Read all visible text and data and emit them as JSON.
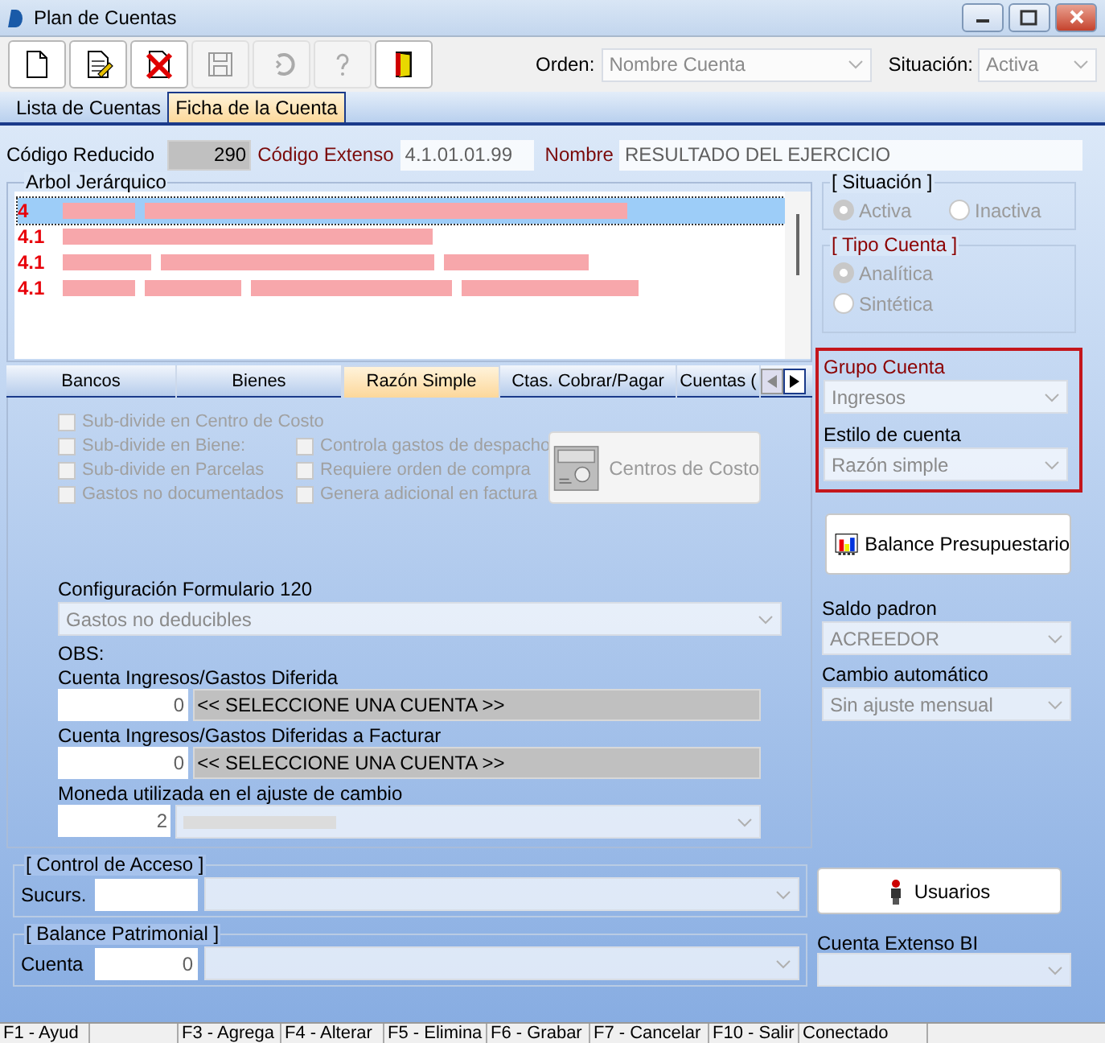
{
  "window": {
    "title": "Plan de Cuentas"
  },
  "toolbar": {
    "buttons": [
      {
        "kind": "new",
        "disabled": false
      },
      {
        "kind": "edit",
        "disabled": false
      },
      {
        "kind": "delete",
        "disabled": false
      },
      {
        "kind": "save",
        "disabled": true
      },
      {
        "kind": "undo",
        "disabled": true
      },
      {
        "kind": "help",
        "disabled": true
      },
      {
        "kind": "exit",
        "disabled": false
      }
    ],
    "order": {
      "label": "Orden:",
      "value": "Nombre Cuenta"
    },
    "status": {
      "label": "Situación:",
      "value": "Activa"
    }
  },
  "tabs": [
    {
      "label": "Lista de Cuentas",
      "selected": false
    },
    {
      "label": "Ficha de la Cuenta",
      "selected": true
    }
  ],
  "header": {
    "short_code_label": "Código Reducido",
    "short_code": "290",
    "extended_code_label": "Código Extenso",
    "extended_code": "4.1.01.01.99",
    "name_label": "Nombre",
    "name": "RESULTADO DEL EJERCICIO"
  },
  "tree": {
    "title": "Arbol Jerárquico",
    "items": [
      {
        "code": "4",
        "selected": true
      },
      {
        "code": "4.1",
        "selected": false
      },
      {
        "code": "4.1",
        "selected": false
      },
      {
        "code": "4.1",
        "selected": false
      }
    ]
  },
  "inner_tabs": [
    {
      "label": "Bancos",
      "selected": false
    },
    {
      "label": "Bienes",
      "selected": false
    },
    {
      "label": "Razón Simple",
      "selected": true
    },
    {
      "label": "Ctas. Cobrar/Pagar",
      "selected": false
    },
    {
      "label": "Cuentas (",
      "selected": false
    }
  ],
  "checks_left": [
    {
      "label": "Sub-divide en Centro de Costo",
      "checked": false
    },
    {
      "label": "Sub-divide en Biene:",
      "checked": false
    },
    {
      "label": "Sub-divide en Parcelas",
      "checked": false
    },
    {
      "label": "Gastos no documentados",
      "checked": false
    }
  ],
  "checks_right": [
    {
      "label": "Controla gastos de despacho",
      "checked": false
    },
    {
      "label": "Requiere orden de compra",
      "checked": false
    },
    {
      "label": "Genera adicional en factura",
      "checked": false
    }
  ],
  "cost_centers_button": "Centros de Costo",
  "form120": {
    "label": "Configuración Formulario 120",
    "value": "Gastos no deducibles"
  },
  "obs_label": "OBS:",
  "deferred": {
    "label": "Cuenta Ingresos/Gastos Diferida",
    "number": "0",
    "account": "<< SELECCIONE UNA CUENTA >>"
  },
  "deferred_invoice": {
    "label": "Cuenta Ingresos/Gastos Diferidas a Facturar",
    "number": "0",
    "account": "<< SELECCIONE UNA CUENTA >>"
  },
  "currency": {
    "label": "Moneda utilizada en el ajuste de cambio",
    "number": "2"
  },
  "situation": {
    "title": "[ Situación ]",
    "options": [
      {
        "label": "Activa",
        "selected": true
      },
      {
        "label": "Inactiva",
        "selected": false
      }
    ]
  },
  "account_type": {
    "title": "[ Tipo Cuenta ]",
    "options": [
      {
        "label": "Analítica",
        "selected": true
      },
      {
        "label": "Sintética",
        "selected": false
      }
    ]
  },
  "group": {
    "label": "Grupo Cuenta",
    "value": "Ingresos"
  },
  "style": {
    "label": "Estilo de cuenta",
    "value": "Razón simple"
  },
  "budget_button": "Balance Presupuestario",
  "balance_default": {
    "label": "Saldo padron",
    "value": "ACREEDOR"
  },
  "auto_exchange": {
    "label": "Cambio automático",
    "value": "Sin ajuste mensual"
  },
  "access": {
    "title": "[ Control de Acceso ]",
    "branch_label": "Sucurs.",
    "users_button": "Usuarios"
  },
  "patrimonial": {
    "title": "[ Balance Patrimonial ]",
    "account_label": "Cuenta",
    "account": "0"
  },
  "bi": {
    "label": "Cuenta Extenso BI"
  },
  "status_bar": [
    "F1 - Ayud",
    "F3 - Agrega",
    "F4 - Alterar",
    "F5 - Elimina",
    "F6 - Grabar",
    "F7 - Cancelar",
    "F10 - Salir",
    "Conectado"
  ]
}
